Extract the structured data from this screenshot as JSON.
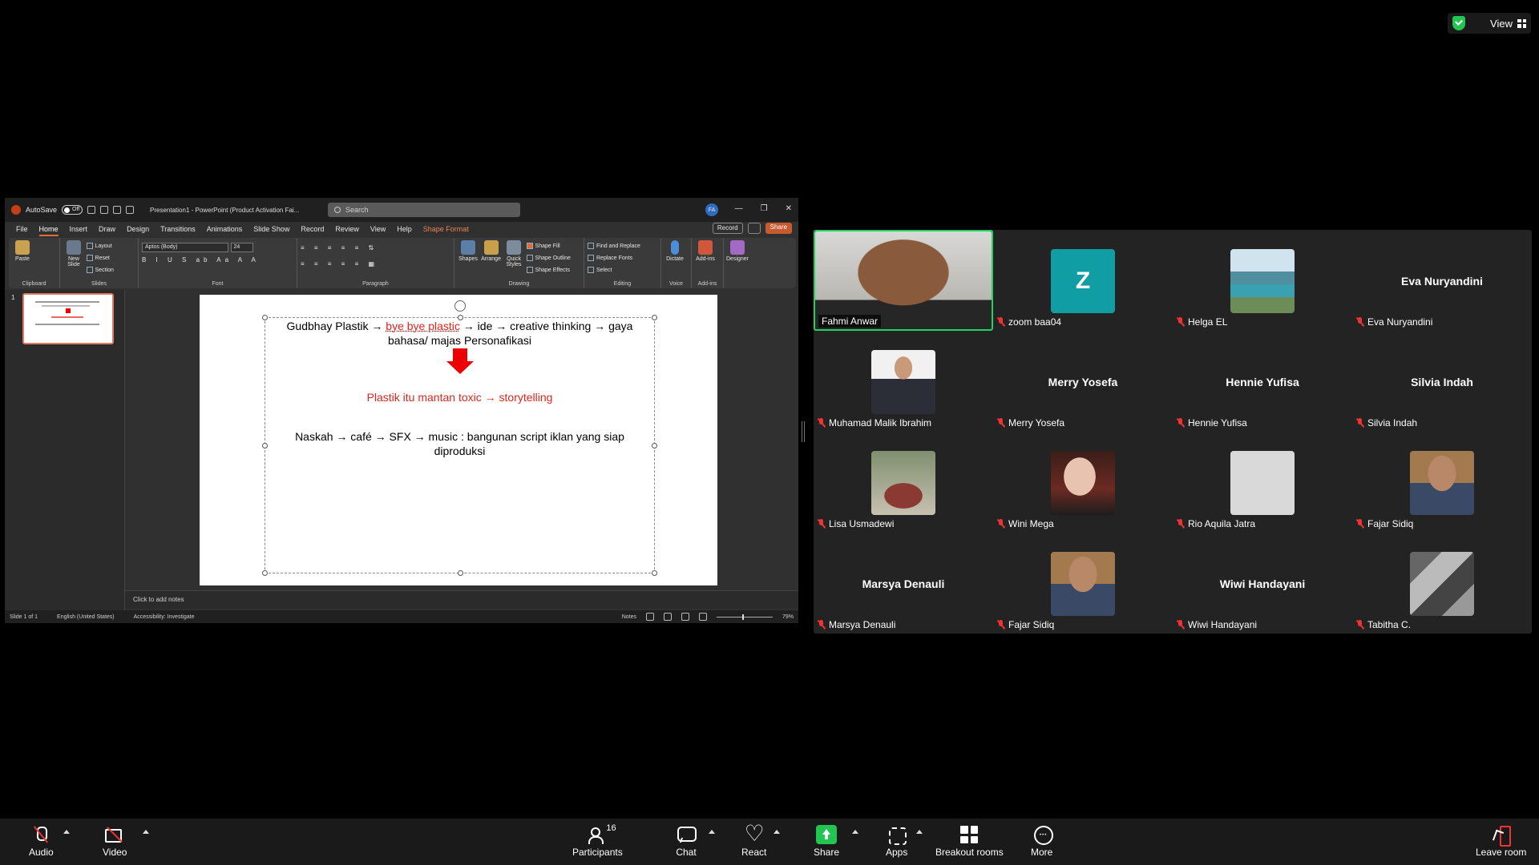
{
  "topbar": {
    "view_label": "View",
    "shield_color": "#23c552"
  },
  "ppt": {
    "autosave_label": "AutoSave",
    "autosave_state": "Off",
    "doc_title": "Presentation1 - PowerPoint (Product Activation Fai...",
    "search_placeholder": "Search",
    "avatar_initials": "FA",
    "tabs": [
      "File",
      "Home",
      "Insert",
      "Draw",
      "Design",
      "Transitions",
      "Animations",
      "Slide Show",
      "Record",
      "Review",
      "View",
      "Help",
      "Shape Format"
    ],
    "record_label": "Record",
    "share_label": "Share",
    "ribbon": {
      "paste": "Paste",
      "clipboard": "Clipboard",
      "new_slide": "New Slide",
      "layout": "Layout",
      "reset": "Reset",
      "section": "Section",
      "slides": "Slides",
      "font_name": "Aptos (Body)",
      "font_size": "24",
      "font": "Font",
      "paragraph": "Paragraph",
      "shapes": "Shapes",
      "arrange": "Arrange",
      "quick_styles": "Quick Styles",
      "shape_fill": "Shape Fill",
      "shape_outline": "Shape Outline",
      "shape_effects": "Shape Effects",
      "drawing": "Drawing",
      "find_replace": "Find and Replace",
      "replace_fonts": "Replace Fonts",
      "select": "Select",
      "editing": "Editing",
      "dictate": "Dictate",
      "voice": "Voice",
      "addins": "Add-ins",
      "addins_group": "Add-ins",
      "designer": "Designer"
    },
    "thumb_number": "1",
    "slide": {
      "line1_a": "Gudbhay Plastik → ",
      "line1_b": "bye bye plastic",
      "line1_c": " → ide → creative thinking → gaya",
      "line2": "bahasa/ majas Personafikasi",
      "line3": "Plastik itu mantan toxic → storytelling",
      "line4": "Naskah → café → SFX → music : bangunan script iklan yang siap",
      "line5": "diproduksi"
    },
    "notes_placeholder": "Click to add notes",
    "status": {
      "slide_of": "Slide 1 of 1",
      "language": "English (United States)",
      "accessibility": "Accessibility: Investigate",
      "notes": "Notes",
      "zoom": "79%"
    }
  },
  "gallery": {
    "tiles": [
      {
        "name": "Fahmi Anwar",
        "kind": "video",
        "ph": "ph-face",
        "muted": false,
        "active": true
      },
      {
        "name": "zoom baa04",
        "kind": "letter",
        "letter": "Z",
        "ph": "ph-z",
        "muted": true
      },
      {
        "name": "Helga EL",
        "kind": "photo",
        "ph": "ph-lake",
        "muted": true
      },
      {
        "name": "Eva Nuryandini",
        "kind": "text",
        "muted": true
      },
      {
        "name": "Muhamad Malik Ibrahim",
        "kind": "photo",
        "ph": "ph-man",
        "muted": true
      },
      {
        "name": "Merry Yosefa",
        "kind": "text",
        "muted": true
      },
      {
        "name": "Hennie Yufisa",
        "kind": "text",
        "muted": true
      },
      {
        "name": "Silvia Indah",
        "kind": "text",
        "muted": true
      },
      {
        "name": "Lisa Usmadewi",
        "kind": "photo",
        "ph": "ph-cake",
        "muted": true
      },
      {
        "name": "Wini Mega",
        "kind": "photo",
        "ph": "ph-woman",
        "muted": true
      },
      {
        "name": "Rio Aquila Jatra",
        "kind": "photo",
        "ph": "ph-grey",
        "muted": true
      },
      {
        "name": "Fajar Sidiq",
        "kind": "photo",
        "ph": "ph-mask",
        "muted": true
      },
      {
        "name": "Marsya Denauli",
        "kind": "text",
        "muted": true
      },
      {
        "name": "Fajar Sidiq",
        "kind": "photo",
        "ph": "ph-mask",
        "muted": true
      },
      {
        "name": "Wiwi Handayani",
        "kind": "text",
        "muted": true
      },
      {
        "name": "Tabitha C.",
        "kind": "photo",
        "ph": "ph-bw",
        "muted": true
      }
    ]
  },
  "toolbar": {
    "audio": "Audio",
    "video": "Video",
    "participants": "Participants",
    "participants_count": "16",
    "chat": "Chat",
    "react": "React",
    "share": "Share",
    "apps": "Apps",
    "breakout": "Breakout rooms",
    "more": "More",
    "leave": "Leave room"
  }
}
